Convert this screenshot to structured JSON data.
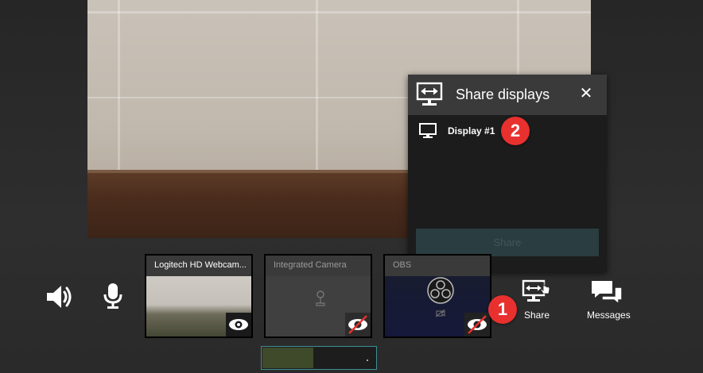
{
  "dialog": {
    "title": "Share displays",
    "close": "✕",
    "displays": [
      {
        "label": "Display #1"
      }
    ],
    "share_label": "Share"
  },
  "badges": {
    "step1": "1",
    "step2": "2"
  },
  "controls": {
    "volume_icon": "speaker-icon",
    "mic_icon": "microphone-icon"
  },
  "cameras": [
    {
      "label": "Logitech HD Webcam...",
      "enabled": true
    },
    {
      "label": "Integrated Camera",
      "enabled": false
    },
    {
      "label": "OBS",
      "enabled": false
    }
  ],
  "actions": {
    "share_label": "Share",
    "messages_label": "Messages"
  },
  "level_meter": {
    "level": 0.45
  },
  "colors": {
    "accent": "#3f8f93",
    "badge": "#e8312e",
    "dialog_header": "#3a3a3a"
  }
}
